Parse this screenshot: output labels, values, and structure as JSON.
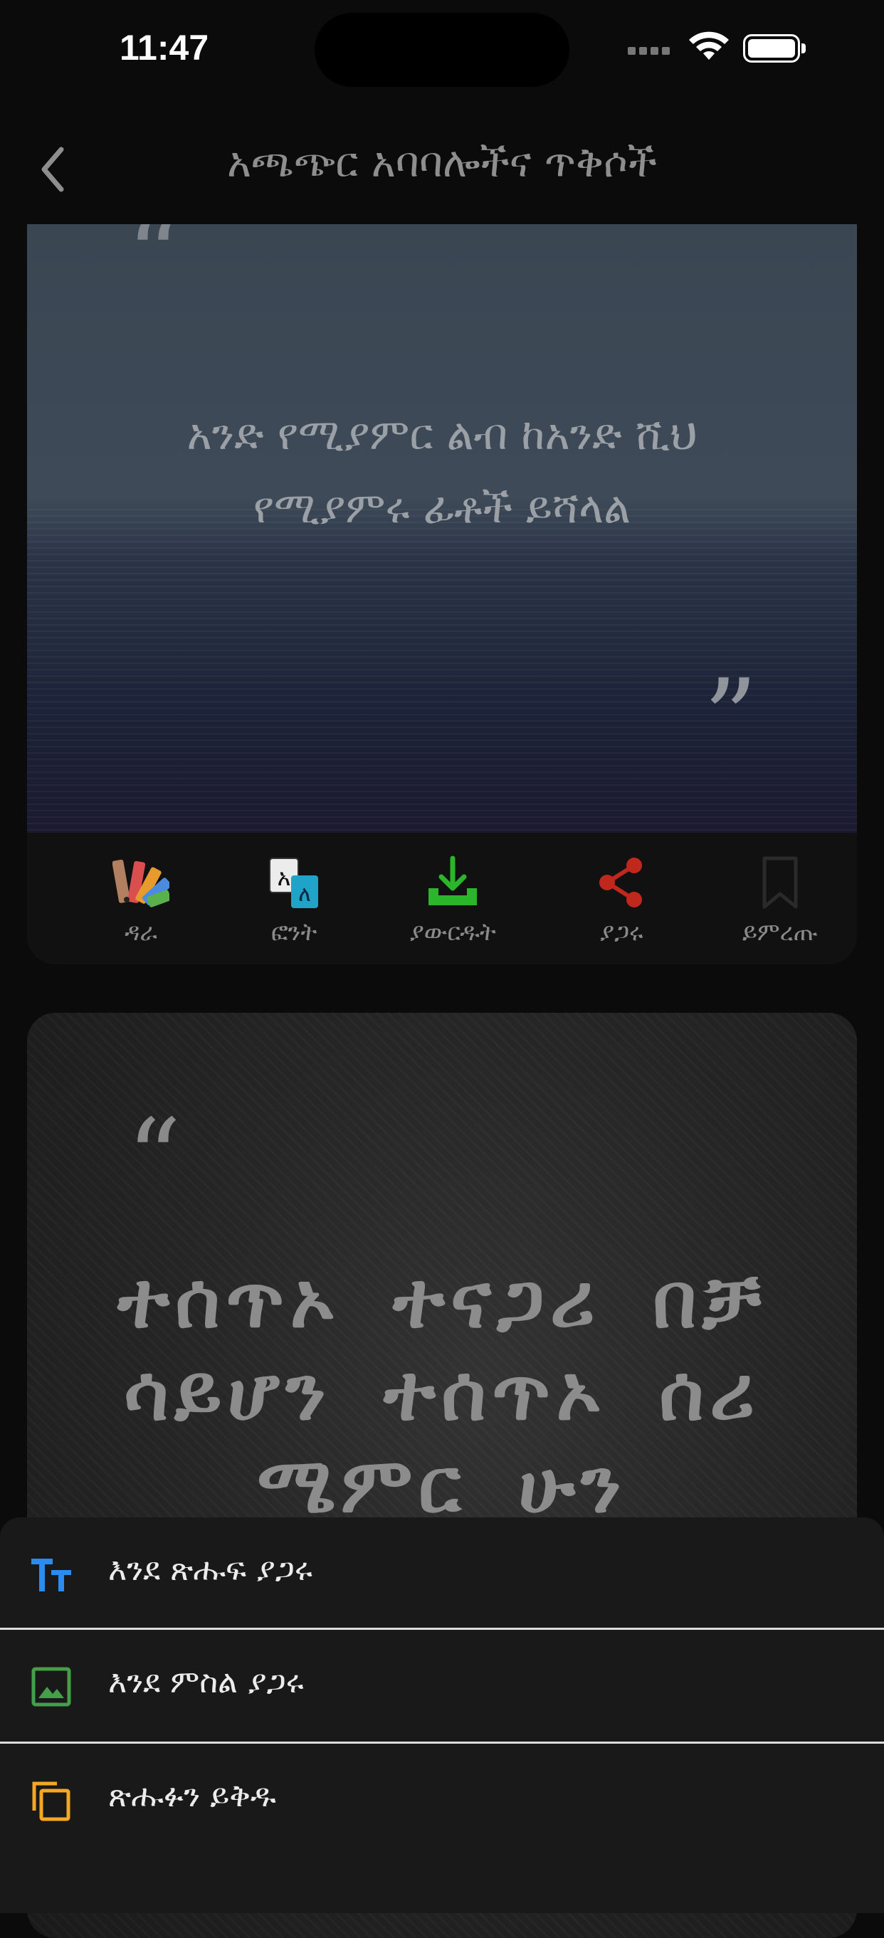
{
  "status_bar": {
    "time": "11:47"
  },
  "nav": {
    "title": "አጫጭር አባባሎችና ጥቅሶች",
    "back_icon": "chevron-left-icon"
  },
  "card1": {
    "open_quote": "“",
    "close_quote": "”",
    "quote_line1": "አንድ የሚያምር ልብ ከአንድ ሺህ",
    "quote_line2": "የሚያምሩ ፊቶች ይሻላል",
    "toolbar": [
      {
        "label": "ዳራ",
        "icon": "palette-icon"
      },
      {
        "label": "ፎንት",
        "icon": "font-icon"
      },
      {
        "label": "ያውርዱት",
        "icon": "download-icon",
        "color": "#2bb52b"
      },
      {
        "label": "ያጋሩ",
        "icon": "share-icon",
        "color": "#c0281e"
      },
      {
        "label": "ይምረጡ",
        "icon": "bookmark-icon"
      }
    ]
  },
  "card2": {
    "open_quote": "“",
    "quote_line1": "ተሰጥኦ ተናጋሪ በቻ",
    "quote_line2": "ሳይሆን ተሰጥኦ ሰሪ",
    "quote_line3": "ሜምር ሁን"
  },
  "share_sheet": {
    "items": [
      {
        "label": "እንደ ጽሑፍ ያጋሩ",
        "icon": "text-size-icon",
        "color": "#2a8cf0"
      },
      {
        "label": "እንደ ምስል ያጋሩ",
        "icon": "image-icon",
        "color": "#43a047"
      },
      {
        "label": "ጽሑፉን ይቅዱ",
        "icon": "copy-icon",
        "color": "#f5a623"
      }
    ]
  }
}
